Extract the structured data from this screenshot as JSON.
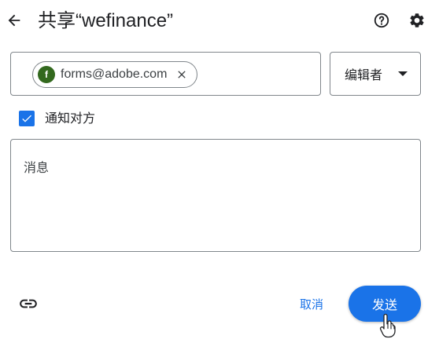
{
  "header": {
    "title": "共享“wefinance”",
    "back_icon": "arrow-left-icon",
    "help_icon": "help-circle-icon",
    "settings_icon": "gear-icon"
  },
  "recipients": {
    "chips": [
      {
        "avatar_letter": "f",
        "email": "forms@adobe.com",
        "avatar_color": "#33691e"
      }
    ]
  },
  "role": {
    "selected": "编辑者"
  },
  "notify": {
    "label": "通知对方",
    "checked": true
  },
  "message": {
    "placeholder": "消息"
  },
  "footer": {
    "cancel_label": "取消",
    "send_label": "发送",
    "link_icon": "link-icon"
  },
  "colors": {
    "accent": "#1a73e8",
    "border": "#80868b",
    "text": "#202124"
  }
}
